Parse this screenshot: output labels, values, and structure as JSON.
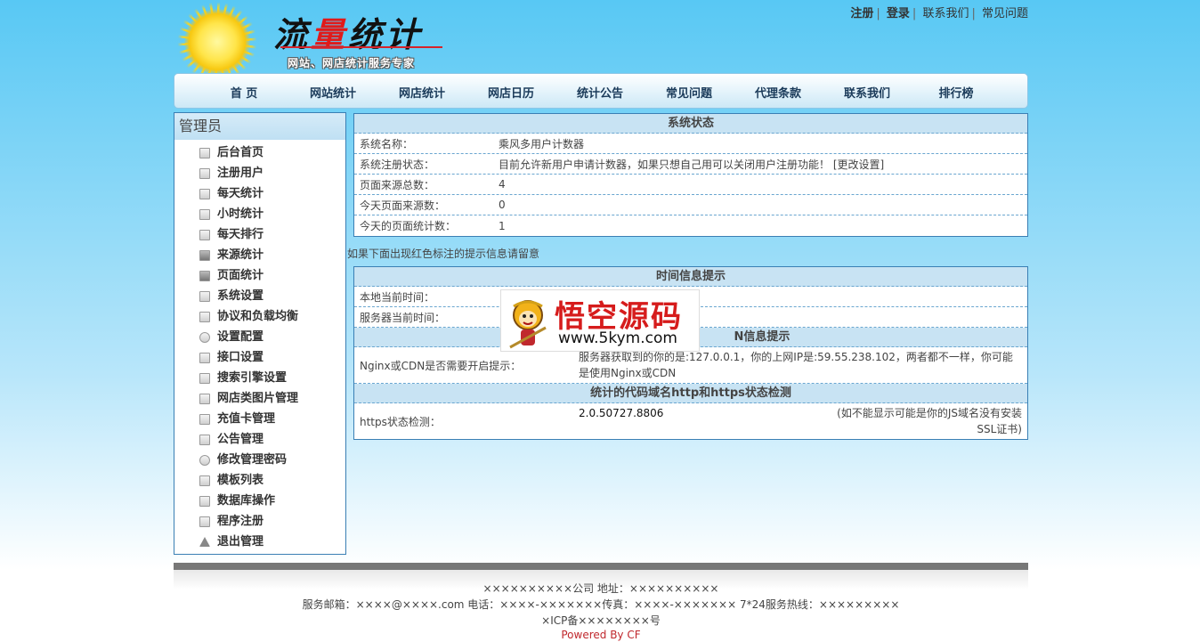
{
  "header": {
    "brand": "流量统计",
    "brand_parts": [
      "流",
      "量",
      "统计"
    ],
    "slogan": "网站、网店统计服务专家",
    "toplinks": {
      "register": "注册",
      "login": "登录",
      "contact": "联系我们",
      "faq": "常见问题"
    }
  },
  "nav": {
    "items": [
      "首 页",
      "网站统计",
      "网店统计",
      "网店日历",
      "统计公告",
      "常见问题",
      "代理条款",
      "联系我们",
      "排行榜"
    ]
  },
  "sidebar": {
    "title": "管理员",
    "items": [
      {
        "label": "后台首页",
        "icon": "page-icon"
      },
      {
        "label": "注册用户",
        "icon": "page-icon"
      },
      {
        "label": "每天统计",
        "icon": "page-icon"
      },
      {
        "label": "小时统计",
        "icon": "page-icon"
      },
      {
        "label": "每天排行",
        "icon": "page-icon"
      },
      {
        "label": "来源统计",
        "icon": "chart-icon"
      },
      {
        "label": "页面统计",
        "icon": "chart-icon"
      },
      {
        "label": "系统设置",
        "icon": "calendar-icon"
      },
      {
        "label": "协议和负载均衡",
        "icon": "server-icon"
      },
      {
        "label": "设置配置",
        "icon": "globe-icon"
      },
      {
        "label": "接口设置",
        "icon": "plug-icon"
      },
      {
        "label": "搜索引擎设置",
        "icon": "lock-icon"
      },
      {
        "label": "网店类图片管理",
        "icon": "image-icon"
      },
      {
        "label": "充值卡管理",
        "icon": "card-icon"
      },
      {
        "label": "公告管理",
        "icon": "lock-icon"
      },
      {
        "label": "修改管理密码",
        "icon": "key-icon"
      },
      {
        "label": "模板列表",
        "icon": "book-icon"
      },
      {
        "label": "数据库操作",
        "icon": "chat-icon"
      },
      {
        "label": "程序注册",
        "icon": "chat-icon"
      },
      {
        "label": "退出管理",
        "icon": "warning-icon"
      }
    ]
  },
  "status": {
    "title": "系统状态",
    "rows": [
      {
        "key": "系统名称：",
        "value": "乘风多用户计数器"
      },
      {
        "key": "系统注册状态：",
        "value": "目前允许新用户申请计数器，如果只想自己用可以关闭用户注册功能！",
        "link": "[更改设置]"
      },
      {
        "key": "页面来源总数：",
        "value": "4"
      },
      {
        "key": "今天页面来源数：",
        "value": "0"
      },
      {
        "key": "今天的页面统计数：",
        "value": "1"
      }
    ]
  },
  "note": "如果下面出现红色标注的提示信息请留意",
  "time": {
    "title": "时间信息提示",
    "local_key": "本地当前时间：",
    "local_value": "",
    "server_key": "服务器当前时间：",
    "server_value": "",
    "cdn_title": "N信息提示",
    "cdn_key": "Nginx或CDN是否需要开启提示：",
    "cdn_value": "服务器获取到的你的是:127.0.0.1，你的上网IP是:59.55.238.102，两者都不一样，你可能是使用Nginx或CDN",
    "https_title": "统计的代码域名http和https状态检测",
    "https_key": "https状态检测：",
    "https_value": "2.0.50727.8806",
    "https_note": "(如不能显示可能是你的JS域名没有安装SSL证书)"
  },
  "watermark": {
    "cn": "悟空源码",
    "url": "www.5kym.com"
  },
  "footer": {
    "line1": "××××××××××公司 地址：××××××××××",
    "line2": "服务邮箱：××××@××××.com 电话：××××-×××××××传真：××××-××××××× 7*24服务热线：×××××××××",
    "line3": "×ICP备××××××××号",
    "powered": "Powered By CF"
  }
}
